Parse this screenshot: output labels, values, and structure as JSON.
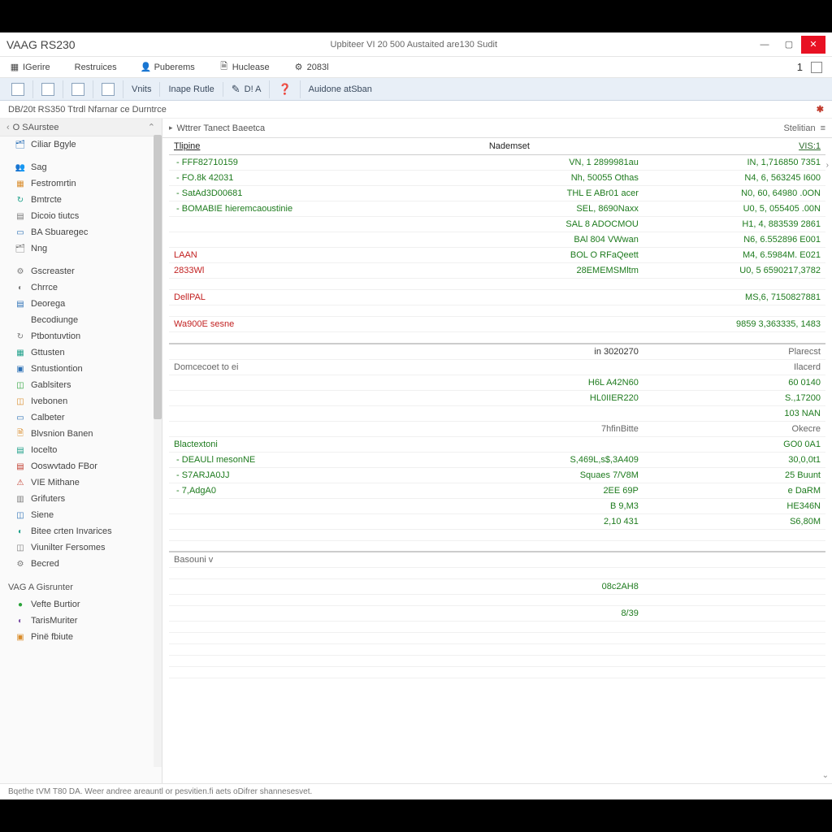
{
  "window": {
    "title": "VAAG RS230",
    "subtitle": "Upbiteer VI 20 500 Austaited are130 Sudit",
    "min": "—",
    "max": "▢",
    "close": "✕",
    "counter": "1"
  },
  "menu": {
    "items": [
      {
        "icon": "▦",
        "label": "IGerire"
      },
      {
        "icon": "",
        "label": "Restruices"
      },
      {
        "icon": "👤",
        "label": "Puberems"
      },
      {
        "icon": "🗎",
        "label": "Huclease"
      },
      {
        "icon": "⚙",
        "label": "2083l"
      }
    ]
  },
  "ribbon": {
    "items": [
      {
        "icon": "▣",
        "label": ""
      },
      {
        "icon": "▣",
        "label": ""
      },
      {
        "icon": "▦",
        "label": ""
      },
      {
        "icon": "▦",
        "label": ""
      },
      {
        "icon": "",
        "label": "Vnits"
      },
      {
        "icon": "",
        "label": "Inape Rutle"
      },
      {
        "icon": "✎",
        "label": "D! A"
      },
      {
        "icon": "❓",
        "label": ""
      },
      {
        "icon": "",
        "label": "Auidone atSban"
      }
    ]
  },
  "breadcrumb": {
    "text": "DB/20t RS350 Ttrdl Nfarnar ce Durntrce"
  },
  "sidebar": {
    "header": "O SAurstee",
    "groups": [
      {
        "items": [
          {
            "icon": "🗂",
            "color": "ic-blue",
            "label": "Ciliar Bgyle"
          }
        ]
      },
      {
        "items": [
          {
            "icon": "👥",
            "color": "ic-blue",
            "label": "Sag"
          },
          {
            "icon": "▦",
            "color": "ic-orange",
            "label": "Festromrtin"
          },
          {
            "icon": "↻",
            "color": "ic-teal",
            "label": "Bmtrcte"
          },
          {
            "icon": "▤",
            "color": "ic-gray",
            "label": "Dicoio tiutcs"
          },
          {
            "icon": "▭",
            "color": "ic-blue",
            "label": "BA Sbuaregec"
          },
          {
            "icon": "🗂",
            "color": "ic-gray",
            "label": "Nng"
          }
        ]
      },
      {
        "items": [
          {
            "icon": "⚙",
            "color": "ic-gray",
            "label": "Gscreaster"
          },
          {
            "icon": "◐",
            "color": "ic-gray",
            "label": "Chrrce"
          },
          {
            "icon": "▤",
            "color": "ic-blue",
            "label": "Deorega"
          },
          {
            "icon": "",
            "color": "",
            "label": "Becodiunge"
          },
          {
            "icon": "↻",
            "color": "ic-gray",
            "label": "Ptbontuvtion"
          },
          {
            "icon": "▦",
            "color": "ic-teal",
            "label": "Gttusten"
          },
          {
            "icon": "▣",
            "color": "ic-blue",
            "label": "Sntustiontion"
          },
          {
            "icon": "◫",
            "color": "ic-green",
            "label": "Gablsiters"
          },
          {
            "icon": "◫",
            "color": "ic-orange",
            "label": "Ivebonen"
          },
          {
            "icon": "▭",
            "color": "ic-blue",
            "label": "Calbeter"
          },
          {
            "icon": "🗎",
            "color": "ic-orange",
            "label": "Blvsnion Banen"
          },
          {
            "icon": "▤",
            "color": "ic-teal",
            "label": "Iocelto"
          },
          {
            "icon": "▤",
            "color": "ic-red",
            "label": "Ooswvtado FBor"
          },
          {
            "icon": "⚠",
            "color": "ic-red",
            "label": "VIE Mithane"
          },
          {
            "icon": "▥",
            "color": "ic-gray",
            "label": "Grifuters"
          },
          {
            "icon": "◫",
            "color": "ic-blue",
            "label": "Siene"
          },
          {
            "icon": "◐",
            "color": "ic-teal",
            "label": "Bitee crten Invarices"
          },
          {
            "icon": "◫",
            "color": "ic-gray",
            "label": "Viunilter Fersomes"
          },
          {
            "icon": "⚙",
            "color": "ic-gray",
            "label": "Becred"
          }
        ]
      }
    ],
    "section2": {
      "title": "VAG A Gisrunter",
      "items": [
        {
          "icon": "●",
          "color": "ic-green",
          "label": "Vefte Burtior"
        },
        {
          "icon": "◐",
          "color": "ic-purple",
          "label": "TarisMuriter"
        },
        {
          "icon": "▣",
          "color": "ic-orange",
          "label": "Pinë fbiute"
        }
      ]
    }
  },
  "sheet": {
    "header": "Wttrer Tanect Baeetca",
    "action": "Stelitian",
    "columns": {
      "c1": "Tlipine",
      "c2": "Nademset",
      "c3": "VIS:1"
    },
    "rows": [
      {
        "c1": "FFF82710159",
        "c2": "VN, 1 2899981au",
        "c3": "IN,  1,716850 7351",
        "s1": "g-green",
        "s2": "g-green",
        "s3": "g-green",
        "ind": true
      },
      {
        "c1": "FO.8k 42031",
        "c2": "Nh, 50055 Othas",
        "c3": "N4, 6, 563245 I600",
        "s1": "g-green",
        "s2": "g-green",
        "s3": "g-green",
        "ind": true
      },
      {
        "c1": "SatAd3D00681",
        "c2": "THL E ABr01 acer",
        "c3": "N0, 60, 64980 .0ON",
        "s1": "g-green",
        "s2": "g-green",
        "s3": "g-green",
        "ind": true
      },
      {
        "c1": "BOMABIE hieremcaoustinie",
        "c2": "SEL, 8690Naxx",
        "c3": "U0, 5, 055405 .00N",
        "s1": "g-green",
        "s2": "g-green",
        "s3": "g-green",
        "ind": true
      },
      {
        "c1": "",
        "c2": "SAL 8 ADOCMOU",
        "c3": "H1, 4,  883539 2861",
        "s1": "",
        "s2": "g-green",
        "s3": "g-green"
      },
      {
        "c1": "",
        "c2": "BAl  804 VWwan",
        "c3": "N6, 6.552896 E001",
        "s1": "",
        "s2": "g-green",
        "s3": "g-green"
      },
      {
        "c1": "LAAN",
        "c2": "BOL O RFaQeett",
        "c3": "M4, 6.5984M. E021",
        "s1": "g-red",
        "s2": "g-green",
        "s3": "g-green"
      },
      {
        "c1": "2833Wl",
        "c2": "28EMEMSMltm",
        "c3": "U0, 5 6590217,3782",
        "s1": "g-red",
        "s2": "g-green",
        "s3": "g-green"
      },
      {
        "blank": true
      },
      {
        "c1": "DellPAL",
        "c2": "",
        "c3": "MS,6, 7150827881",
        "s1": "g-red",
        "s2": "",
        "s3": "g-green"
      },
      {
        "blank": true
      },
      {
        "c1": "Wa900E sesne",
        "c2": "",
        "c3": "9859 3,363335, 1483",
        "s1": "g-red",
        "s2": "",
        "s3": "g-green"
      },
      {
        "blank": true
      },
      {
        "c1": "",
        "c2": "",
        "c3": "Plarecst",
        "s3": "g-gray",
        "sep": true,
        "right2": "in   3020270"
      },
      {
        "c1": "Domcecoet to ei",
        "c2": "",
        "c3": "Ilacerd",
        "s1": "g-gray",
        "s3": "g-gray"
      },
      {
        "c1": "",
        "c2": "H6L A42N60",
        "c3": "60 0140",
        "s2": "g-green",
        "s3": "g-green"
      },
      {
        "c1": "",
        "c2": "HL0IIER220",
        "c3": "S.,17200",
        "s2": "g-green",
        "s3": "g-green"
      },
      {
        "c1": "",
        "c2": "",
        "c3": "103 NAN",
        "s3": "g-green"
      },
      {
        "c1": "",
        "c2": "7hfinBitte",
        "c3": "Okecre",
        "s2": "g-gray",
        "s3": "g-gray"
      },
      {
        "c1": "Blactextoni",
        "c2": "",
        "c3": "GO0 0A1",
        "s1": "g-green",
        "s3": "g-green"
      },
      {
        "c1": "DEAULl mesonNE",
        "c2": "S,469L,s$,3A409",
        "c3": "30,0,0t1",
        "s1": "g-green",
        "s2": "g-green",
        "s3": "g-green",
        "ind": true
      },
      {
        "c1": "S7ARJA0JJ",
        "c2": "Squaes 7/V8M",
        "c3": "25 Buunt",
        "s1": "g-green",
        "s2": "g-green",
        "s3": "g-green",
        "ind": true
      },
      {
        "c1": "7,AdgA0",
        "c2": "2EE       69P",
        "c3": "e DaRM",
        "s1": "g-green",
        "s2": "g-green",
        "s3": "g-green",
        "ind": true
      },
      {
        "c1": "",
        "c2": "B 9,M3",
        "c3": "HE346N",
        "s2": "g-green",
        "s3": "g-green"
      },
      {
        "c1": "",
        "c2": "2,10 431",
        "c3": "S6,80M",
        "s2": "g-green",
        "s3": "g-green"
      },
      {
        "blank": true
      },
      {
        "blank": true
      },
      {
        "c1": "Basouni  v",
        "c2": "",
        "c3": "",
        "s1": "g-gray",
        "sep": true
      },
      {
        "blank": true
      },
      {
        "c1": "",
        "c2": "08c2AH8",
        "c3": "",
        "s2": "g-green"
      },
      {
        "blank": true
      },
      {
        "c1": "",
        "c2": "8/39",
        "c3": "",
        "s2": "g-green"
      },
      {
        "blank": true
      },
      {
        "blank": true
      },
      {
        "blank": true
      },
      {
        "blank": true
      },
      {
        "blank": true
      }
    ]
  },
  "footer": {
    "text": "Bqethe tVM T80 DA.   Weer andree areauntl or pesvitien.fi aets oDifrer shannesesvet."
  }
}
